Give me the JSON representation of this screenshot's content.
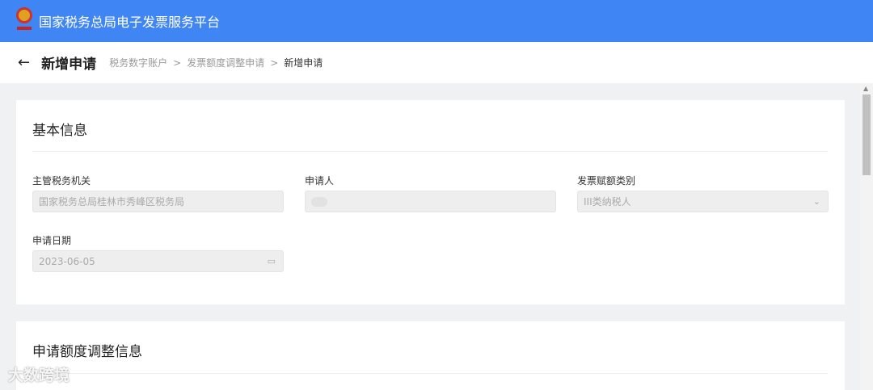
{
  "header": {
    "title": "国家税务总局电子发票服务平台"
  },
  "page": {
    "title": "新增申请",
    "breadcrumb": [
      "税务数字账户",
      "发票额度调整申请",
      "新增申请"
    ]
  },
  "basic": {
    "title": "基本信息",
    "tax_authority": {
      "label": "主管税务机关",
      "value": "国家税务总局桂林市秀峰区税务局"
    },
    "applicant": {
      "label": "申请人"
    },
    "category": {
      "label": "发票赋额类别",
      "value": "III类纳税人"
    },
    "date": {
      "label": "申请日期",
      "value": "2023-06-05"
    }
  },
  "adjust": {
    "title": "申请额度调整信息"
  },
  "watermark": "大数跨境"
}
